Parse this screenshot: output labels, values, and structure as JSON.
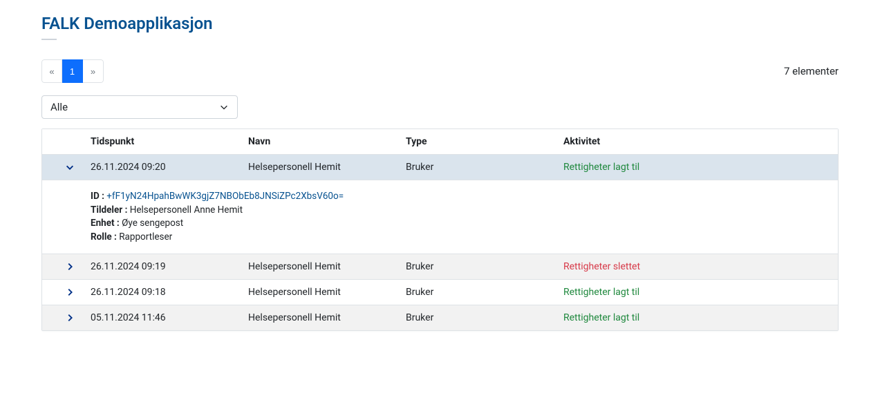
{
  "header": {
    "title": "FALK Demoapplikasjon"
  },
  "pagination": {
    "prev": "«",
    "next": "»",
    "current": "1"
  },
  "count_text": "7 elementer",
  "filter": {
    "selected": "Alle"
  },
  "table": {
    "headers": {
      "tidspunkt": "Tidspunkt",
      "navn": "Navn",
      "type": "Type",
      "aktivitet": "Aktivitet"
    },
    "rows": [
      {
        "tidspunkt": "26.11.2024 09:20",
        "navn": "Helsepersonell Hemit",
        "type": "Bruker",
        "aktivitet": "Rettigheter lagt til",
        "aktivitet_kind": "added"
      },
      {
        "tidspunkt": "26.11.2024 09:19",
        "navn": "Helsepersonell Hemit",
        "type": "Bruker",
        "aktivitet": "Rettigheter slettet",
        "aktivitet_kind": "deleted"
      },
      {
        "tidspunkt": "26.11.2024 09:18",
        "navn": "Helsepersonell Hemit",
        "type": "Bruker",
        "aktivitet": "Rettigheter lagt til",
        "aktivitet_kind": "added"
      },
      {
        "tidspunkt": "05.11.2024 11:46",
        "navn": "Helsepersonell Hemit",
        "type": "Bruker",
        "aktivitet": "Rettigheter lagt til",
        "aktivitet_kind": "added"
      }
    ],
    "expanded_detail": {
      "id_label": "ID :",
      "id_value": "+fF1yN24HpahBwWK3gjZ7NBObEb8JNSiZPc2XbsV60o=",
      "tildeler_label": "Tildeler :",
      "tildeler_value": "Helsepersonell Anne Hemit",
      "enhet_label": "Enhet :",
      "enhet_value": "Øye sengepost",
      "rolle_label": "Rolle :",
      "rolle_value": "Rapportleser"
    }
  }
}
